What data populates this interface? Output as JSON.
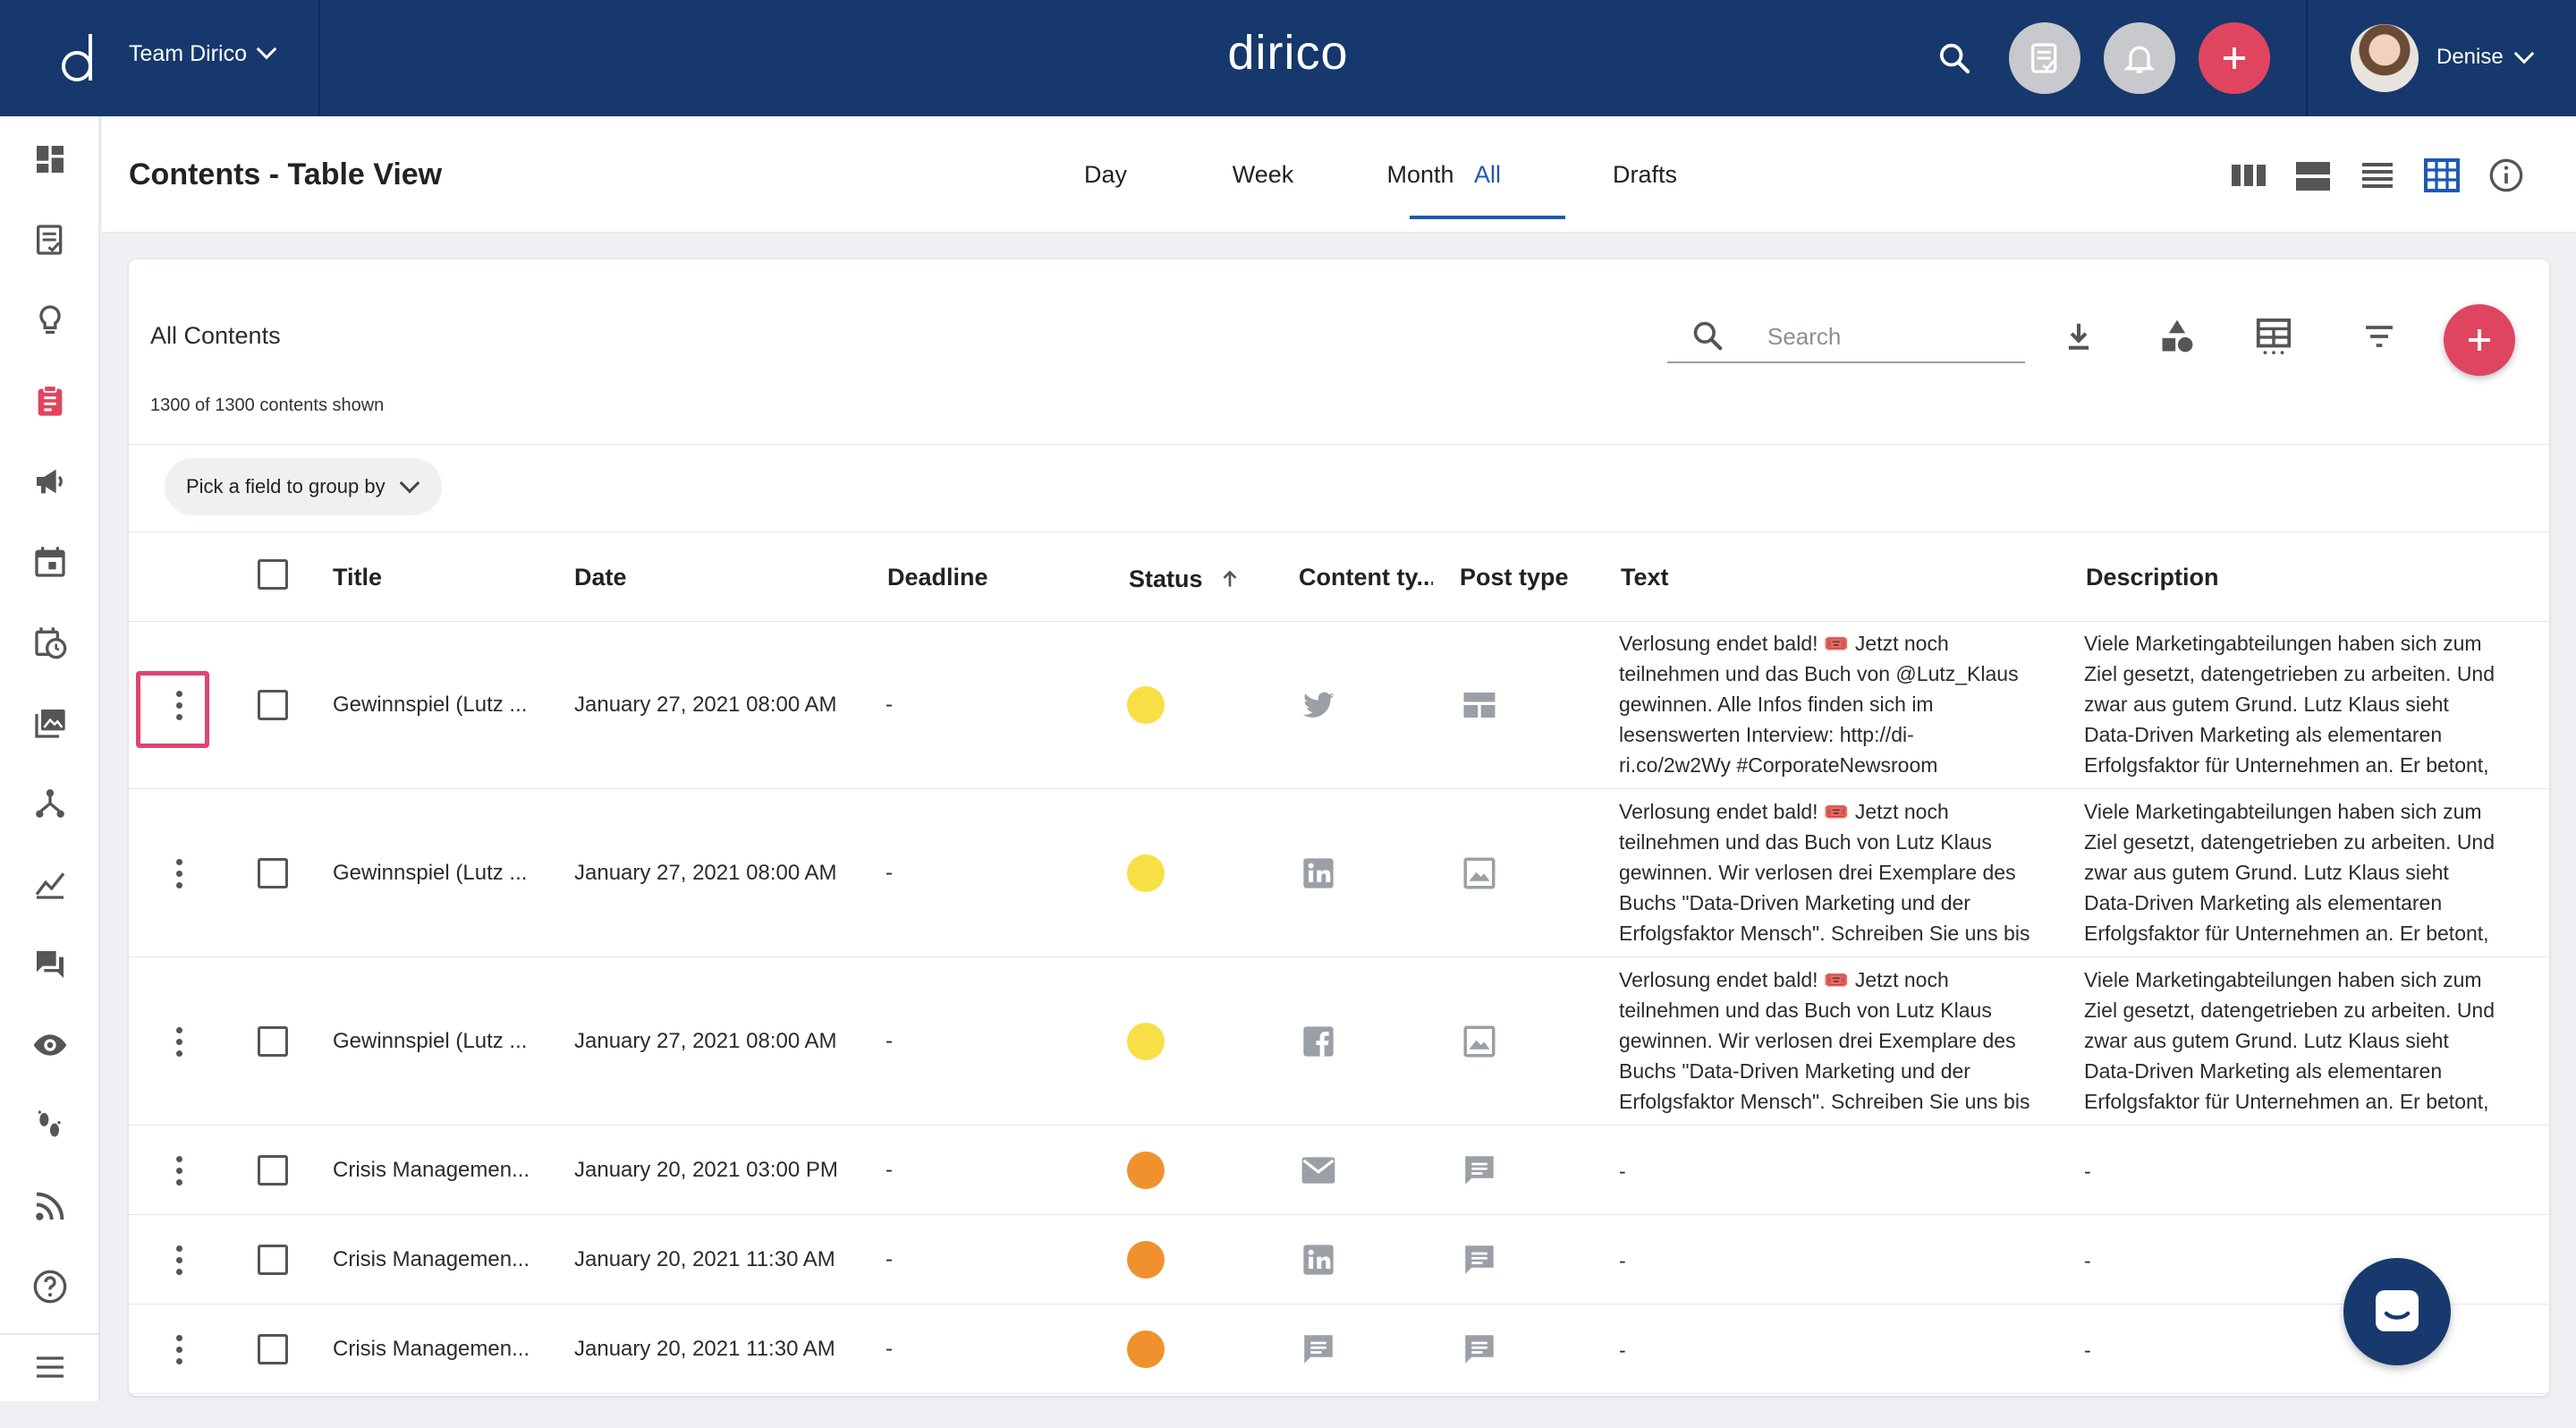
{
  "topbar": {
    "team_label": "Team Dirico",
    "brand": "dirico",
    "user_name": "Denise",
    "colors": {
      "bar": "#16386c",
      "add": "#e0455f",
      "neutral_circle": "#c7c9cc"
    },
    "icons": [
      "search-icon",
      "task-list-icon",
      "bell-icon",
      "add-icon"
    ]
  },
  "sidebar": {
    "icons": [
      "dashboard-icon",
      "task-list-icon",
      "lightbulb-icon",
      "clipboard-icon",
      "megaphone-icon",
      "calendar-icon",
      "schedule-icon",
      "media-library-icon",
      "hierarchy-icon",
      "analytics-icon",
      "forum-icon",
      "eye-icon",
      "footsteps-icon",
      "rss-icon",
      "help-icon",
      "menu-icon"
    ]
  },
  "page": {
    "title": "Contents - Table View",
    "tabs": [
      "Day",
      "Week",
      "Month",
      "All",
      "Drafts"
    ],
    "active_tab": "All",
    "view_icons": [
      "columns-view-icon",
      "rows-view-icon",
      "list-view-icon",
      "table-view-icon",
      "info-icon"
    ]
  },
  "card": {
    "heading": "All Contents",
    "count_text": "1300 of 1300 contents shown",
    "search_placeholder": "Search",
    "group_by_label": "Pick a field to group by",
    "tool_icons": [
      "download-icon",
      "shapes-icon",
      "table-columns-icon",
      "filter-icon",
      "add-icon"
    ]
  },
  "table": {
    "columns": [
      "Title",
      "Date",
      "Deadline",
      "Status",
      "Content ty...",
      "Post type",
      "Text",
      "Description"
    ],
    "sort_column": "Status",
    "rows": [
      {
        "title": "Gewinnspiel (Lutz ...",
        "date": "January 27, 2021 08:00 AM",
        "deadline": "-",
        "status_color": "#f7df45",
        "content_type_icon": "twitter-icon",
        "post_type_icon": "layout-icon",
        "text": "Verlosung endet bald! 🎟️ Jetzt noch\nteilnehmen und das Buch von @Lutz_Klaus\ngewinnen. Alle Infos finden sich im\nlesenswerten Interview: http://di-\nri.co/2w2Wy #CorporateNewsroom",
        "description": "Viele Marketingabteilungen haben sich zum\nZiel gesetzt, datengetrieben zu arbeiten. Und\nzwar aus gutem Grund. Lutz Klaus sieht\nData-Driven Marketing als elementaren\nErfolgsfaktor für Unternehmen an. Er betont,"
      },
      {
        "title": "Gewinnspiel (Lutz ...",
        "date": "January 27, 2021 08:00 AM",
        "deadline": "-",
        "status_color": "#f7df45",
        "content_type_icon": "linkedin-icon",
        "post_type_icon": "image-icon",
        "text": "Verlosung endet bald! 🎟️ Jetzt noch\nteilnehmen und das Buch von Lutz Klaus\ngewinnen. Wir verlosen drei Exemplare des\nBuchs \"Data-Driven Marketing und der\nErfolgsfaktor Mensch\". Schreiben Sie uns bis",
        "description": "Viele Marketingabteilungen haben sich zum\nZiel gesetzt, datengetrieben zu arbeiten. Und\nzwar aus gutem Grund. Lutz Klaus sieht\nData-Driven Marketing als elementaren\nErfolgsfaktor für Unternehmen an. Er betont,"
      },
      {
        "title": "Gewinnspiel (Lutz ...",
        "date": "January 27, 2021 08:00 AM",
        "deadline": "-",
        "status_color": "#f7df45",
        "content_type_icon": "facebook-icon",
        "post_type_icon": "image-icon",
        "text": "Verlosung endet bald! 🎟️ Jetzt noch\nteilnehmen und das Buch von Lutz Klaus\ngewinnen. Wir verlosen drei Exemplare des\nBuchs \"Data-Driven Marketing und der\nErfolgsfaktor Mensch\". Schreiben Sie uns bis",
        "description": "Viele Marketingabteilungen haben sich zum\nZiel gesetzt, datengetrieben zu arbeiten. Und\nzwar aus gutem Grund. Lutz Klaus sieht\nData-Driven Marketing als elementaren\nErfolgsfaktor für Unternehmen an. Er betont,"
      },
      {
        "title": "Crisis Managemen...",
        "date": "January 20, 2021 03:00 PM",
        "deadline": "-",
        "status_color": "#f0912e",
        "content_type_icon": "mail-icon",
        "post_type_icon": "chat-icon",
        "text": "-",
        "description": "-"
      },
      {
        "title": "Crisis Managemen...",
        "date": "January 20, 2021 11:30 AM",
        "deadline": "-",
        "status_color": "#f0912e",
        "content_type_icon": "linkedin-icon",
        "post_type_icon": "chat-icon",
        "text": "-",
        "description": "-"
      },
      {
        "title": "Crisis Managemen...",
        "date": "January 20, 2021 11:30 AM",
        "deadline": "-",
        "status_color": "#f0912e",
        "content_type_icon": "chat-icon",
        "post_type_icon": "chat-icon",
        "text": "-",
        "description": "-"
      }
    ]
  },
  "chat_widget": {
    "icon": "chat-bubble-icon",
    "color": "#17396d"
  }
}
